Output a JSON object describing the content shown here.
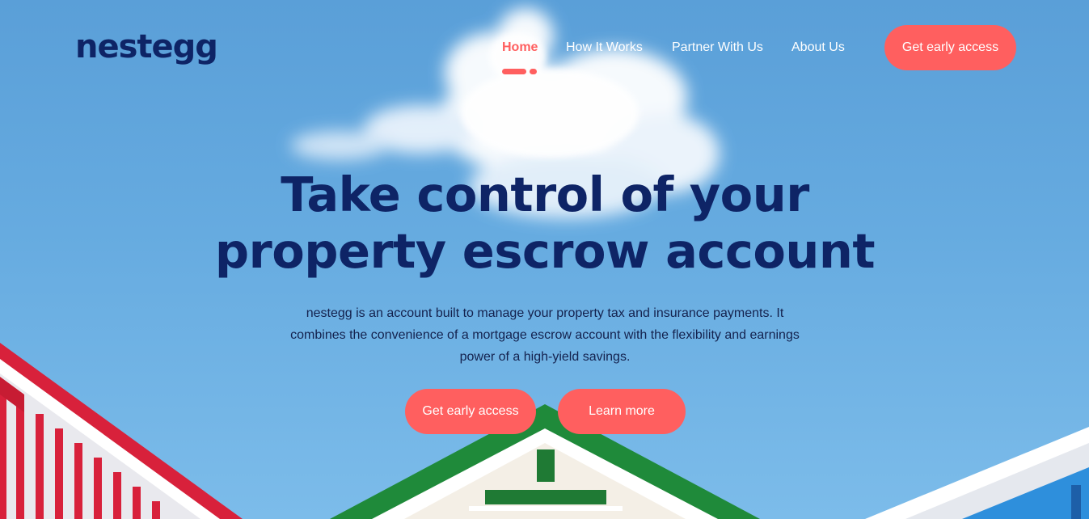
{
  "header": {
    "logo": "nestegg",
    "nav": [
      {
        "label": "Home",
        "active": true
      },
      {
        "label": "How It Works",
        "active": false
      },
      {
        "label": "Partner With Us",
        "active": false
      },
      {
        "label": "About Us",
        "active": false
      }
    ],
    "cta_label": "Get early access"
  },
  "hero": {
    "title_line1": "Take control of your",
    "title_line2": "property escrow account",
    "description": "nestegg is an account built to manage your property tax and insurance payments. It combines the convenience of a mortgage escrow account with the flexibility and earnings power of a high-yield savings.",
    "primary_cta": "Get early access",
    "secondary_cta": "Learn more"
  },
  "colors": {
    "accent": "#ff5f5f",
    "brand_navy": "#0e2466",
    "sky": "#66abe0",
    "roof_green": "#1f8a3a",
    "house_red": "#d8213b",
    "house_blue": "#2e8fdc"
  }
}
